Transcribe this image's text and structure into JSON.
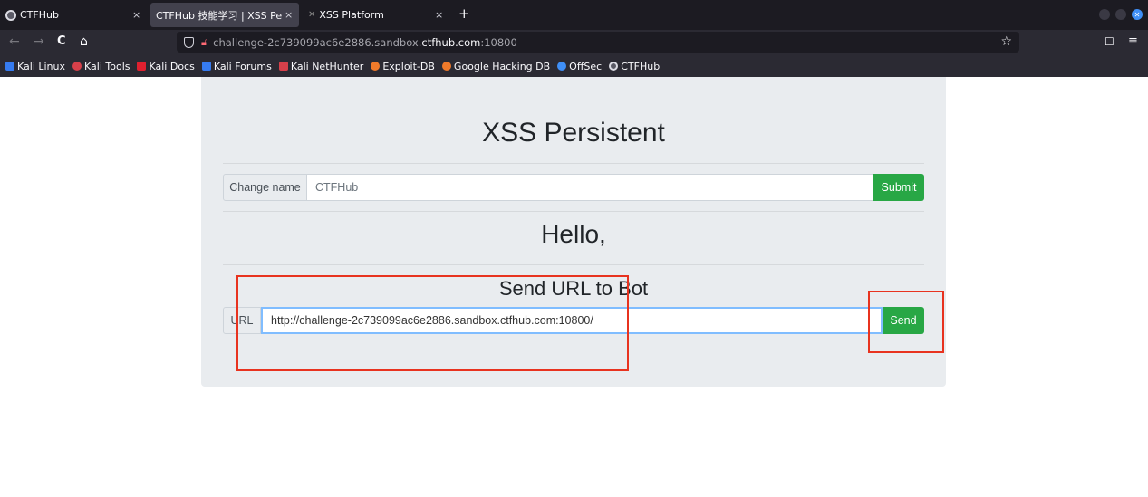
{
  "browser": {
    "tabs": [
      {
        "title": "CTFHub",
        "close": "×"
      },
      {
        "title": "CTFHub 技能学习 | XSS Persi",
        "close": "×"
      },
      {
        "title": "XSS Platform",
        "close": "×"
      }
    ],
    "new_tab": "+",
    "nav": {
      "back": "←",
      "forward": "→",
      "reload": "C",
      "home": "⌂"
    },
    "url": {
      "subdomain": "challenge-2c739099ac6e2886.sandbox.",
      "domain": "ctfhub.com",
      "port": ":10800"
    },
    "bookmark_star": "☆",
    "bookmarks": [
      {
        "label": "Kali Linux",
        "color": "#367bf0"
      },
      {
        "label": "Kali Tools",
        "color": "#d7404a"
      },
      {
        "label": "Kali Docs",
        "color": "#e0202f"
      },
      {
        "label": "Kali Forums",
        "color": "#367bf0"
      },
      {
        "label": "Kali NetHunter",
        "color": "#d7404a"
      },
      {
        "label": "Exploit-DB",
        "color": "#f07a2a"
      },
      {
        "label": "Google Hacking DB",
        "color": "#f07a2a"
      },
      {
        "label": "OffSec",
        "color": "#3f8ff7"
      },
      {
        "label": "CTFHub",
        "color": "#dcdce4"
      }
    ]
  },
  "page": {
    "title": "XSS Persistent",
    "change_name": {
      "label": "Change name",
      "value": "CTFHub",
      "button": "Submit"
    },
    "hello": "Hello,",
    "send": {
      "heading": "Send URL to Bot",
      "label": "URL",
      "value": "http://challenge-2c739099ac6e2886.sandbox.ctfhub.com:10800/",
      "button": "Send"
    }
  },
  "colors": {
    "accent_green": "#28a745",
    "annotation_red": "#e8331f"
  }
}
